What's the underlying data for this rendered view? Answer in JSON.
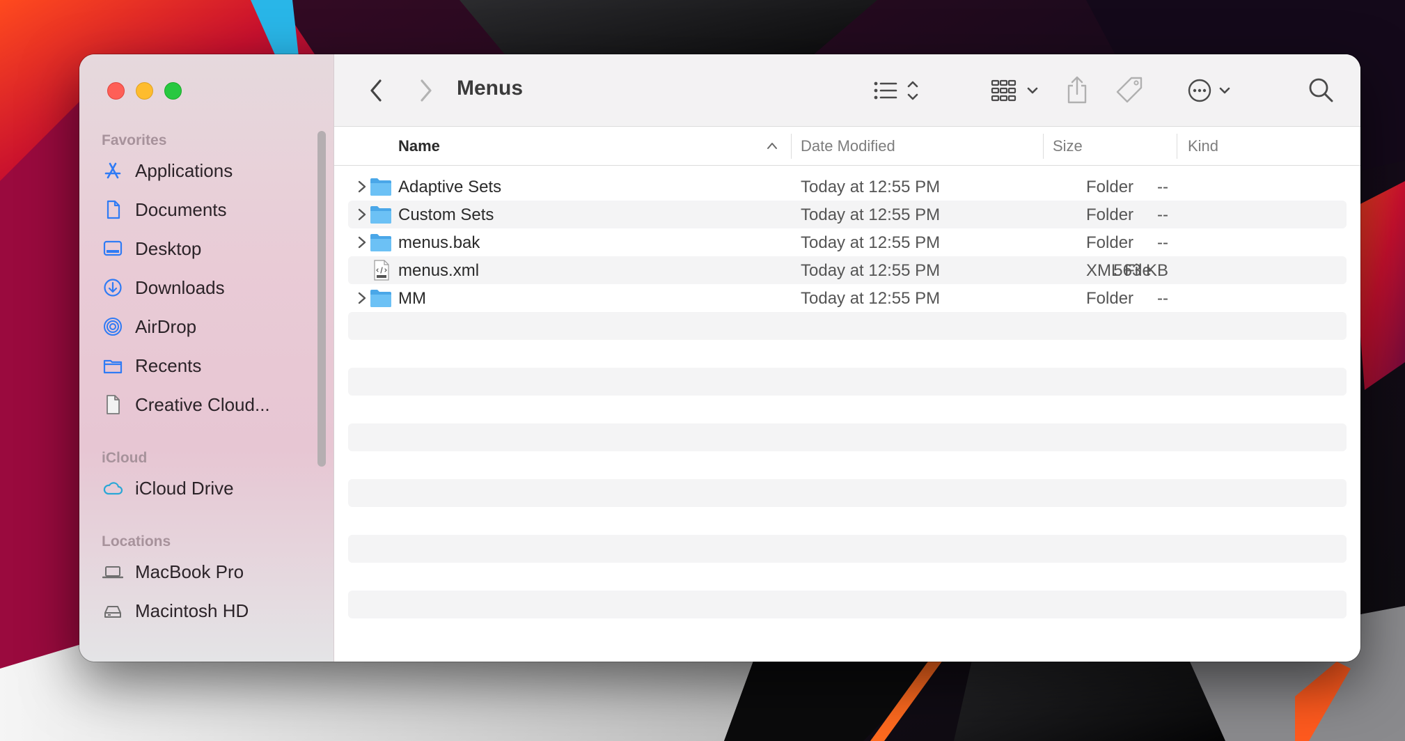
{
  "window": {
    "title": "Menus"
  },
  "sidebar": {
    "sections": [
      {
        "label": "Favorites",
        "items": [
          {
            "label": "Applications",
            "icon": "applications-icon"
          },
          {
            "label": "Documents",
            "icon": "document-icon"
          },
          {
            "label": "Desktop",
            "icon": "desktop-icon"
          },
          {
            "label": "Downloads",
            "icon": "downloads-icon"
          },
          {
            "label": "AirDrop",
            "icon": "airdrop-icon"
          },
          {
            "label": "Recents",
            "icon": "folder-icon"
          },
          {
            "label": "Creative Cloud...",
            "icon": "file-icon"
          }
        ]
      },
      {
        "label": "iCloud",
        "items": [
          {
            "label": "iCloud Drive",
            "icon": "cloud-icon"
          }
        ]
      },
      {
        "label": "Locations",
        "items": [
          {
            "label": "MacBook Pro",
            "icon": "laptop-icon"
          },
          {
            "label": "Macintosh HD",
            "icon": "harddrive-icon"
          }
        ]
      }
    ]
  },
  "columns": {
    "name": "Name",
    "date": "Date Modified",
    "size": "Size",
    "kind": "Kind"
  },
  "files": [
    {
      "name": "Adaptive Sets",
      "date": "Today at 12:55 PM",
      "size": "--",
      "kind": "Folder",
      "type": "folder"
    },
    {
      "name": "Custom Sets",
      "date": "Today at 12:55 PM",
      "size": "--",
      "kind": "Folder",
      "type": "folder"
    },
    {
      "name": "menus.bak",
      "date": "Today at 12:55 PM",
      "size": "--",
      "kind": "Folder",
      "type": "folder"
    },
    {
      "name": "menus.xml",
      "date": "Today at 12:55 PM",
      "size": "563 KB",
      "kind": "XML File",
      "type": "xml"
    },
    {
      "name": "MM",
      "date": "Today at 12:55 PM",
      "size": "--",
      "kind": "Folder",
      "type": "folder"
    }
  ],
  "colors": {
    "accent": "#2f7bf5",
    "folder": "#5cb8f2",
    "close": "#fe5f57",
    "minimize": "#febc2e",
    "maximize": "#28c840"
  }
}
